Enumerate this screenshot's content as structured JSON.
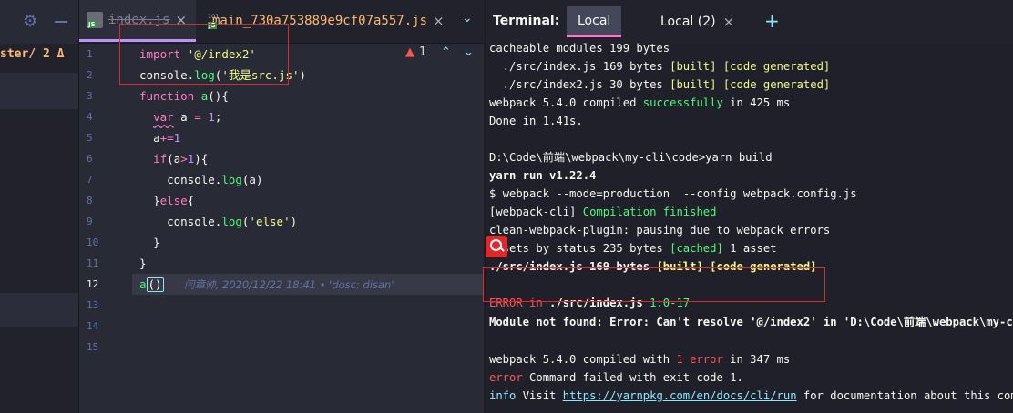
{
  "project_panel": {
    "settings_icon": "gear-icon",
    "hide_icon": "minus-icon",
    "branch_label": "ster",
    "branch_separator": "/",
    "warning_count": "2",
    "warning_glyph": "Δ"
  },
  "editor": {
    "tabs": [
      {
        "label": "index.js",
        "icon": "js-file-icon"
      },
      {
        "label": "main_730a753889e9cf07a557.js",
        "icon": "js-binary-file-icon"
      }
    ],
    "warning_count": "1",
    "line_numbers": [
      "1",
      "2",
      "3",
      "4",
      "5",
      "6",
      "7",
      "8",
      "9",
      "10",
      "11",
      "12",
      "13",
      "14",
      "15"
    ],
    "code": {
      "l1_kw": "import",
      "l1_str": "'@/index2'",
      "l2_obj": "console.",
      "l2_fn": "log",
      "l2_open": "(",
      "l2_str": "'我是src.js'",
      "l2_close": ")",
      "l3_kw": "function",
      "l3_name": "a",
      "l3_rest": "(){",
      "l4_kw": "var",
      "l4_mid": " a ",
      "l4_op": "=",
      "l4_num": "1",
      "l4_end": ";",
      "l5_var": "a",
      "l5_op": "+=",
      "l5_num": "1",
      "l6_kw": "if",
      "l6_a": "(a",
      "l6_op": ">",
      "l6_num": "1",
      "l6_end": "){",
      "l7_obj": "console.",
      "l7_fn": "log",
      "l7_rest": "(a)",
      "l8_open": "}",
      "l8_kw": "else",
      "l8_close": "{",
      "l9_obj": "console.",
      "l9_fn": "log",
      "l9_open": "(",
      "l9_str": "'else'",
      "l9_close": ")",
      "l10": "}",
      "l11": "}",
      "l12_call": "a",
      "l12_paren": "()",
      "l12_blame": "闫章帅, 2020/12/22 18:41 • 'dosc: disan'"
    }
  },
  "terminal": {
    "label": "Terminal:",
    "tabs": [
      {
        "label": "Local"
      },
      {
        "label": "Local (2)"
      }
    ],
    "lines": {
      "t1": "cacheable modules 199 bytes",
      "t2_path": "  ./src/index.js 169 bytes ",
      "t2_built": "[built]",
      "t2_sp": " ",
      "t2_gen": "[code generated]",
      "t3_path": "  ./src/index2.js 30 bytes ",
      "t3_built": "[built]",
      "t3_sp": " ",
      "t3_gen": "[code generated]",
      "t4_a": "webpack 5.4.0 compiled ",
      "t4_ok": "successfully",
      "t4_b": " in 425 ms",
      "t5": "Done in 1.41s.",
      "t7": "D:\\Code\\前端\\webpack\\my-cli\\code>yarn build",
      "t8": "yarn run v1.22.4",
      "t9": "$ webpack --mode=production  --config webpack.config.js",
      "t10_tag": "[webpack-cli] ",
      "t10_msg": "Compilation finished",
      "t11": "clean-webpack-plugin: pausing due to webpack errors",
      "t12_a": "assets by status 235 bytes ",
      "t12_cached": "[cached]",
      "t12_b": " 1 asset",
      "t13_path": "./src/index.js 169 bytes ",
      "t13_built": "[built]",
      "t13_sp": " ",
      "t13_gen": "[code generated]",
      "t15_err": "ERROR",
      "t15_in": " in ",
      "t15_path": "./src/index.js",
      "t15_pos": " 1:0-17",
      "t16": "Module not found: Error: Can't resolve '@/index2' in 'D:\\Code\\前端\\webpack\\my-cli\\",
      "t18_a": "webpack 5.4.0 compiled with ",
      "t18_err": "1 error",
      "t18_b": " in 347 ms",
      "t19_err": "error",
      "t19_msg": " Command failed with exit code 1.",
      "t20_info": "info",
      "t20_a": " Visit ",
      "t20_link": "https://yarnpkg.com/en/docs/cli/run",
      "t20_b": " for documentation about this comman"
    }
  },
  "colors": {
    "annotation_box": "#e0282a",
    "active_tab_underline": "#ff79c6",
    "editor_tab_underline": "#bd93f9"
  }
}
